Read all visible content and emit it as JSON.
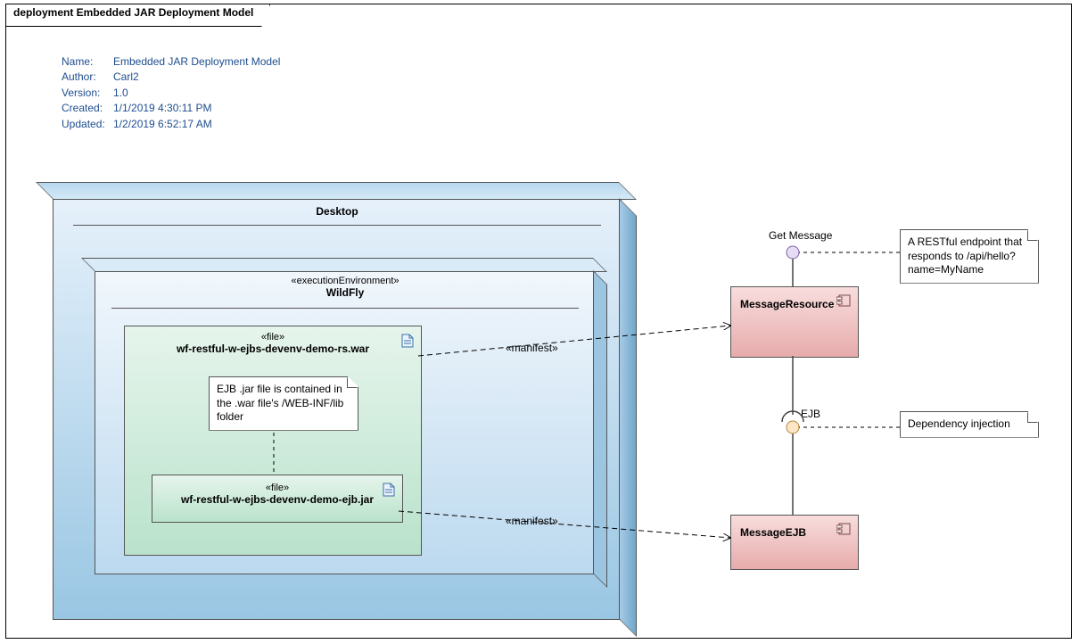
{
  "frame": {
    "title": "deployment Embedded JAR Deployment Model"
  },
  "meta": {
    "name_label": "Name:",
    "name": "Embedded JAR Deployment Model",
    "author_label": "Author:",
    "author": "Carl2",
    "version_label": "Version:",
    "version": "1.0",
    "created_label": "Created:",
    "created": "1/1/2019 4:30:11 PM",
    "updated_label": "Updated:",
    "updated": "1/2/2019 6:52:17 AM"
  },
  "nodes": {
    "desktop": {
      "title": "Desktop"
    },
    "wildfly": {
      "stereotype": "«executionEnvironment»",
      "title": "WildFly"
    },
    "war": {
      "stereotype": "«file»",
      "title": "wf-restful-w-ejbs-devenv-demo-rs.war"
    },
    "jar": {
      "stereotype": "«file»",
      "title": "wf-restful-w-ejbs-devenv-demo-ejb.jar"
    },
    "messageResource": {
      "title": "MessageResource"
    },
    "messageEJB": {
      "title": "MessageEJB"
    }
  },
  "interfaces": {
    "getMessage": "Get Message",
    "ejb": "EJB"
  },
  "notes": {
    "contained": "EJB .jar file is contained in the .war file's /WEB-INF/lib folder",
    "restful": "A RESTful endpoint that responds to /api/hello?name=MyName",
    "di": "Dependency injection"
  },
  "edges": {
    "manifest1": "«manifest»",
    "manifest2": "«manifest»"
  }
}
